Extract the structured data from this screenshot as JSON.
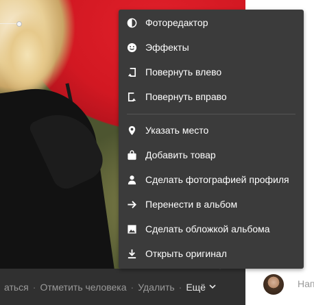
{
  "bottom_bar": {
    "partial_action": "аться",
    "tag_person": "Отметить человека",
    "delete": "Удалить",
    "more": "Ещё",
    "separator": "·"
  },
  "comment": {
    "placeholder_partial": "Нап"
  },
  "menu": {
    "items": [
      {
        "label": "Фоторедактор",
        "icon": "contrast-icon"
      },
      {
        "label": "Эффекты",
        "icon": "smiley-icon"
      },
      {
        "label": "Повернуть влево",
        "icon": "rotate-left-icon"
      },
      {
        "label": "Повернуть вправо",
        "icon": "rotate-right-icon"
      },
      {
        "label": "Указать место",
        "icon": "location-pin-icon"
      },
      {
        "label": "Добавить товар",
        "icon": "shopping-bag-icon"
      },
      {
        "label": "Сделать фотографией профиля",
        "icon": "person-icon"
      },
      {
        "label": "Перенести в альбом",
        "icon": "arrow-right-icon"
      },
      {
        "label": "Сделать обложкой альбома",
        "icon": "image-icon"
      },
      {
        "label": "Открыть оригинал",
        "icon": "download-icon"
      }
    ]
  },
  "colors": {
    "menu_bg": "#3b3b3b",
    "bar_bg": "#303030",
    "text_muted": "#9a9a9a",
    "text_light": "#ffffff"
  }
}
